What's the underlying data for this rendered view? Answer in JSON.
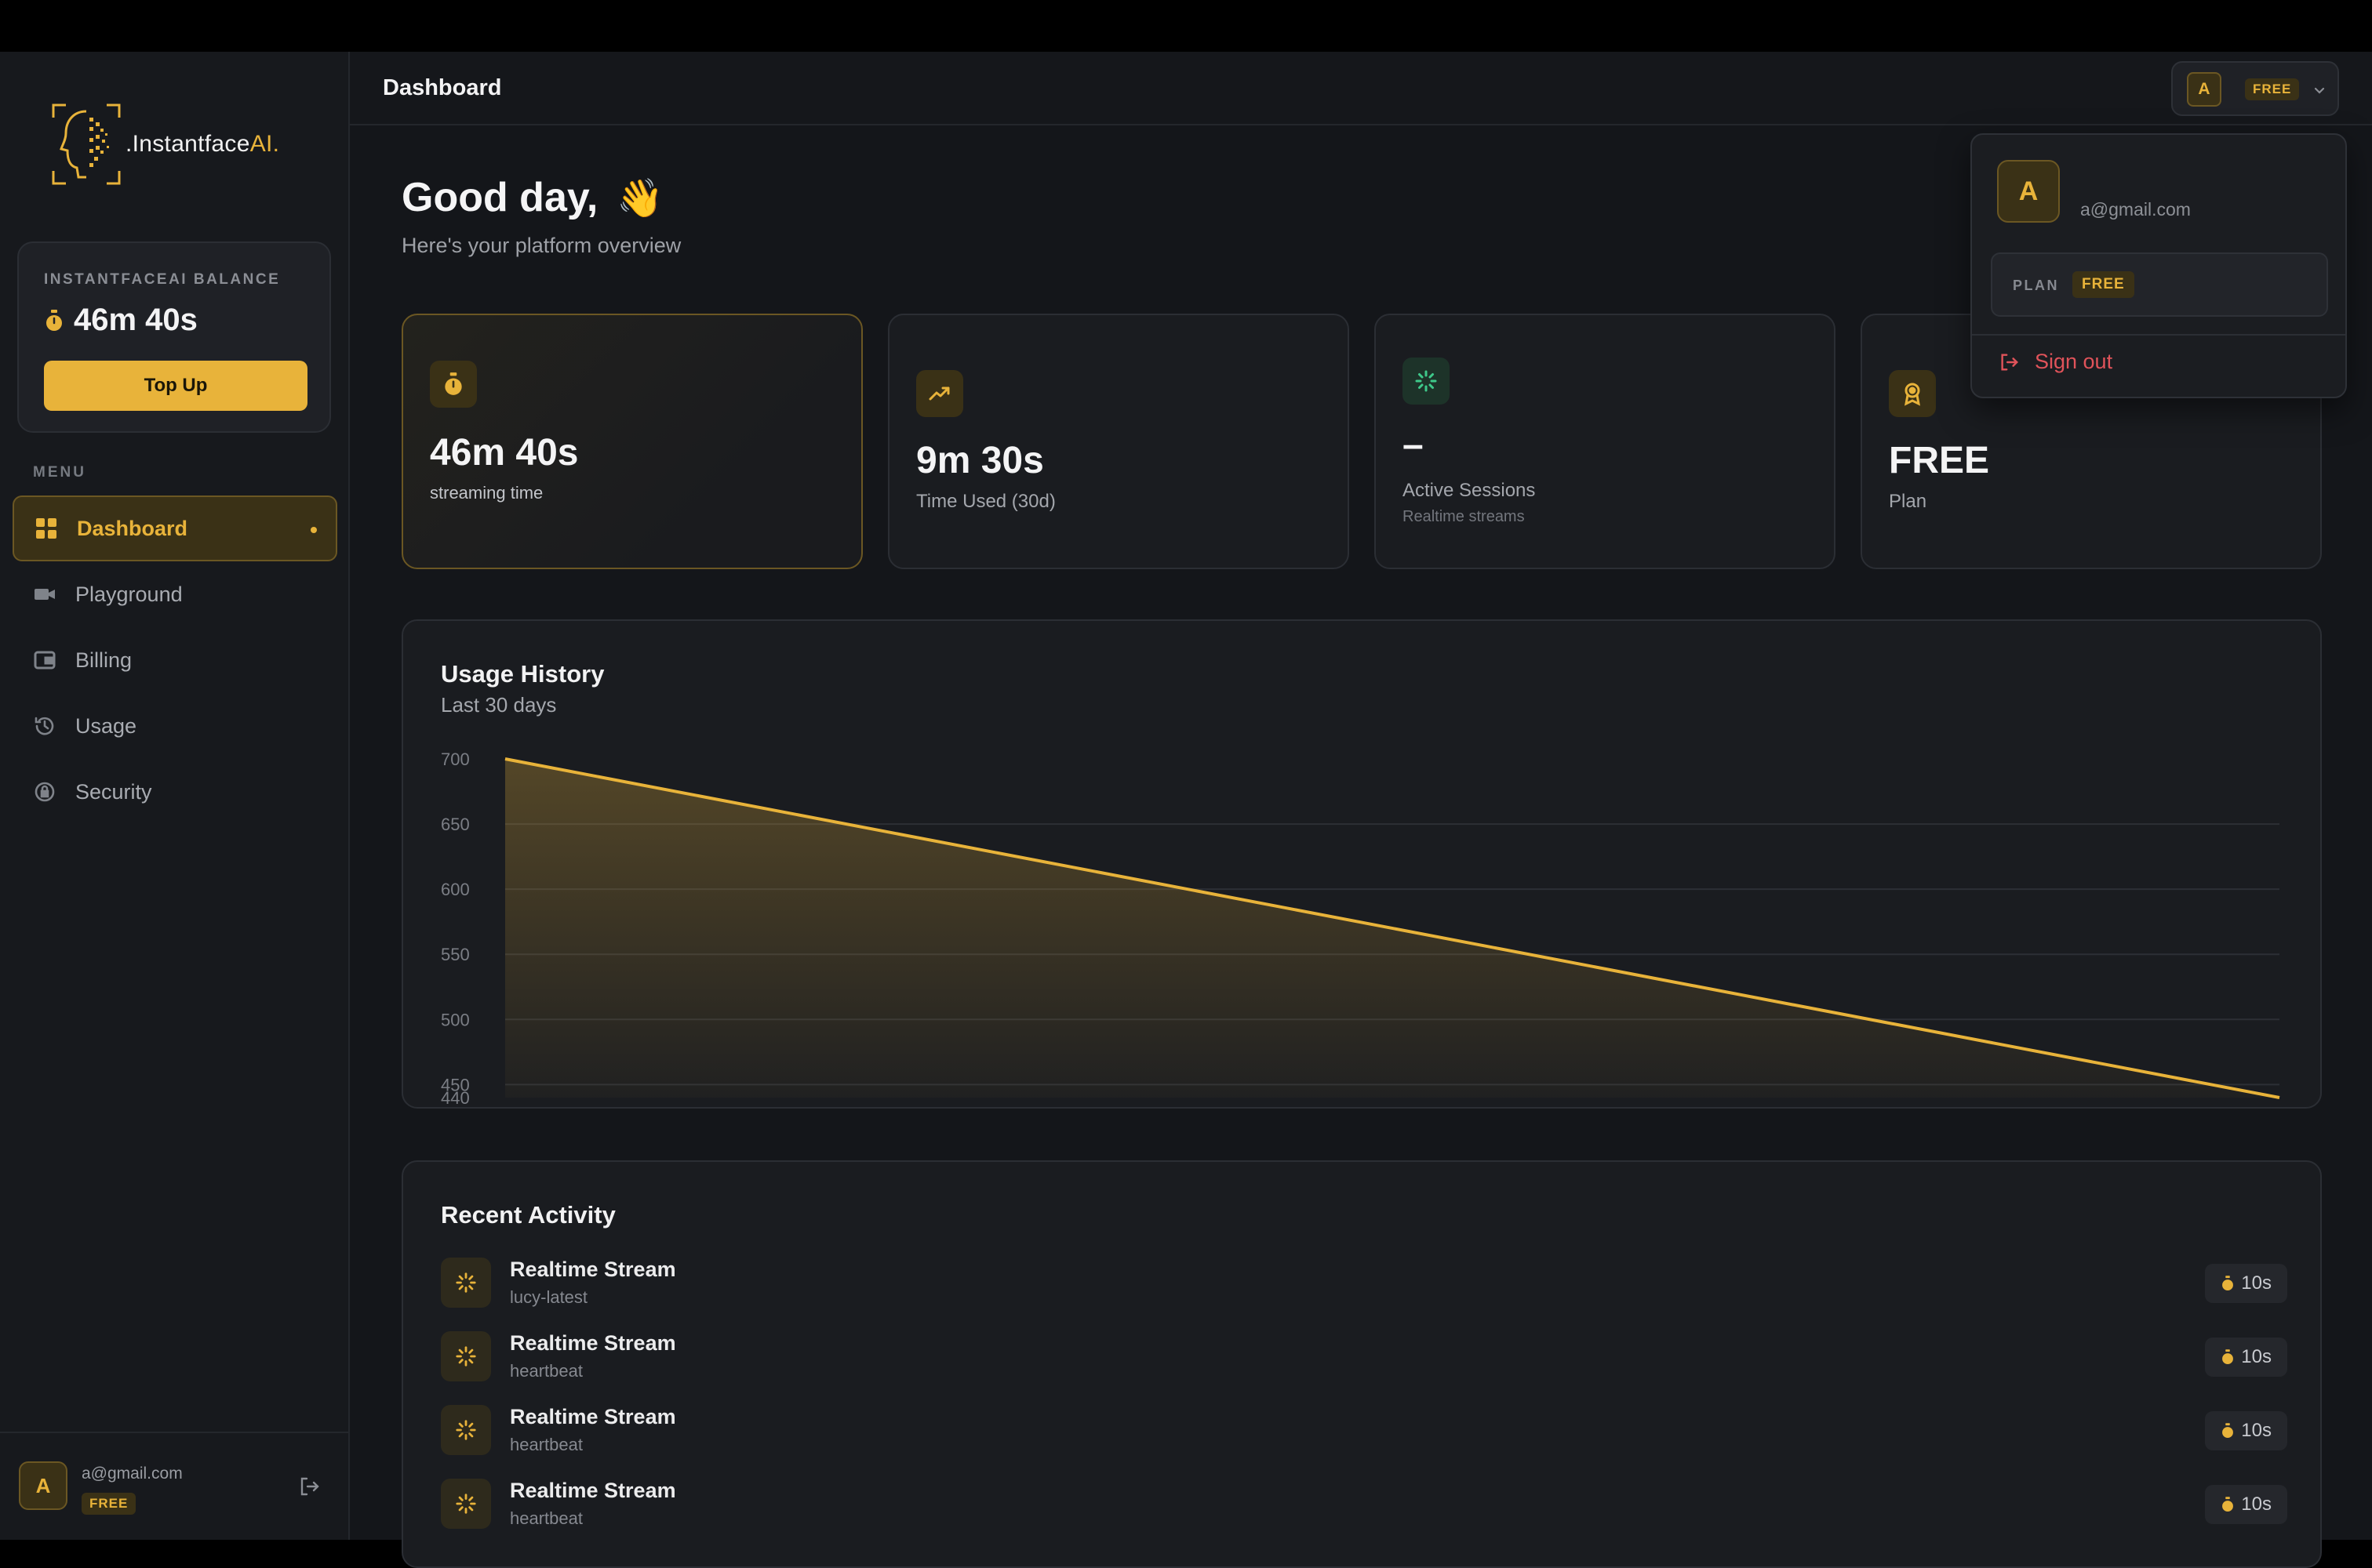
{
  "brand": {
    "name_prefix": ".Instantface",
    "name_suffix": "AI."
  },
  "colors": {
    "accent": "#e8b33a",
    "danger": "#e0535a",
    "success": "#3ec98a",
    "background": "#14161a"
  },
  "balance": {
    "label": "INSTANTFACEAI BALANCE",
    "value": "46m 40s",
    "topup_label": "Top Up"
  },
  "menu": {
    "label": "MENU",
    "items": [
      {
        "label": "Dashboard",
        "icon": "grid-icon",
        "active": true
      },
      {
        "label": "Playground",
        "icon": "video-camera-icon"
      },
      {
        "label": "Billing",
        "icon": "wallet-icon"
      },
      {
        "label": "Usage",
        "icon": "history-icon"
      },
      {
        "label": "Security",
        "icon": "shield-lock-icon"
      }
    ]
  },
  "sidebar_footer": {
    "avatar": "A",
    "email": "a@gmail.com",
    "plan": "FREE"
  },
  "header": {
    "title": "Dashboard",
    "avatar": "A",
    "plan": "FREE"
  },
  "greeting": {
    "title": "Good day,",
    "emoji": "👋",
    "subtitle": "Here's your platform overview"
  },
  "stats": [
    {
      "value": "46m 40s",
      "label": "streaming time",
      "icon": "stopwatch-icon"
    },
    {
      "value": "9m 30s",
      "label": "Time Used (30d)",
      "icon": "trend-up-icon"
    },
    {
      "value": "–",
      "label": "Active Sessions",
      "sub": "Realtime streams",
      "icon": "spinner-icon"
    },
    {
      "value": "FREE",
      "label": "Plan",
      "icon": "award-icon"
    }
  ],
  "usage": {
    "title": "Usage History",
    "subtitle": "Last 30 days"
  },
  "chart_data": {
    "type": "area",
    "x": [
      0,
      1
    ],
    "values": [
      700,
      440
    ],
    "yticks": [
      700,
      650,
      600,
      550,
      500,
      450,
      440
    ],
    "ylim": [
      440,
      700
    ],
    "grid": true,
    "legend": "none",
    "color": "#e8b33a"
  },
  "activity": {
    "title": "Recent Activity",
    "items": [
      {
        "name": "Realtime Stream",
        "model": "lucy-latest",
        "duration": "10s"
      },
      {
        "name": "Realtime Stream",
        "model": "heartbeat",
        "duration": "10s"
      },
      {
        "name": "Realtime Stream",
        "model": "heartbeat",
        "duration": "10s"
      },
      {
        "name": "Realtime Stream",
        "model": "heartbeat",
        "duration": "10s"
      }
    ]
  },
  "dropdown": {
    "avatar": "A",
    "email": "a@gmail.com",
    "plan_label": "PLAN",
    "plan": "FREE",
    "signout_label": "Sign out"
  }
}
